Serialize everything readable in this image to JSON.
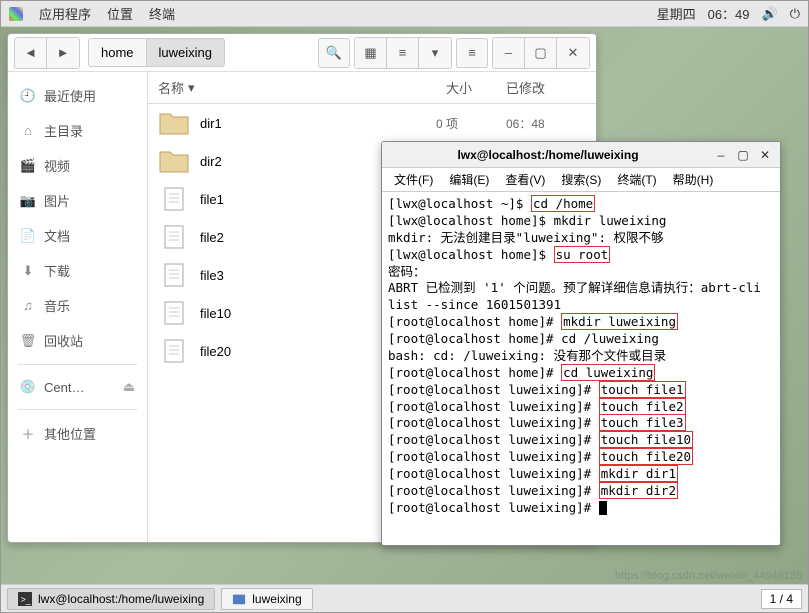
{
  "panel": {
    "apps": "应用程序",
    "places": "位置",
    "terminal": "终端",
    "day": "星期四",
    "time": "06：49"
  },
  "fm": {
    "breadcrumb": [
      "home",
      "luweixing"
    ],
    "cols": {
      "name": "名称",
      "size": "大小",
      "mod": "已修改"
    },
    "rows": [
      {
        "name": "dir1",
        "type": "folder",
        "size": "0 项",
        "mod": "06：48"
      },
      {
        "name": "dir2",
        "type": "folder",
        "size": "",
        "mod": ""
      },
      {
        "name": "file1",
        "type": "file",
        "size": "",
        "mod": ""
      },
      {
        "name": "file2",
        "type": "file",
        "size": "",
        "mod": ""
      },
      {
        "name": "file3",
        "type": "file",
        "size": "",
        "mod": ""
      },
      {
        "name": "file10",
        "type": "file",
        "size": "",
        "mod": ""
      },
      {
        "name": "file20",
        "type": "file",
        "size": "",
        "mod": ""
      }
    ],
    "sidebar": {
      "recent": "最近使用",
      "home": "主目录",
      "videos": "视频",
      "pictures": "图片",
      "documents": "文档",
      "downloads": "下载",
      "music": "音乐",
      "trash": "回收站",
      "cent": "Cent…",
      "other": "其他位置"
    }
  },
  "term": {
    "title": "lwx@localhost:/home/luweixing",
    "menu": [
      "文件(F)",
      "编辑(E)",
      "查看(V)",
      "搜索(S)",
      "终端(T)",
      "帮助(H)"
    ],
    "lines": [
      {
        "pre": "[lwx@localhost ~]$ ",
        "boxed": "cd /home",
        "post": ""
      },
      {
        "pre": "[lwx@localhost home]$ mkdir luweixing",
        "boxed": "",
        "post": ""
      },
      {
        "pre": "mkdir: 无法创建目录\"luweixing\": 权限不够",
        "boxed": "",
        "post": ""
      },
      {
        "pre": "[lwx@localhost home]$ ",
        "boxed": "su root",
        "post": ""
      },
      {
        "pre": "密码：",
        "boxed": "",
        "post": ""
      },
      {
        "pre": "ABRT 已检测到 '1' 个问题。预了解详细信息请执行：abrt-cli list --since 1601501391",
        "boxed": "",
        "post": ""
      },
      {
        "pre": "[root@localhost home]# ",
        "boxed": "mkdir luweixing",
        "post": ""
      },
      {
        "pre": "[root@localhost home]# cd /luweixing",
        "boxed": "",
        "post": ""
      },
      {
        "pre": "bash: cd: /luweixing: 没有那个文件或目录",
        "boxed": "",
        "post": ""
      },
      {
        "pre": "[root@localhost home]# ",
        "boxed": "cd luweixing",
        "post": ""
      },
      {
        "pre": "[root@localhost luweixing]# ",
        "boxed": "touch file1",
        "post": ""
      },
      {
        "pre": "[root@localhost luweixing]# ",
        "boxed": "touch file2",
        "post": ""
      },
      {
        "pre": "[root@localhost luweixing]# ",
        "boxed": "touch file3",
        "post": ""
      },
      {
        "pre": "[root@localhost luweixing]# ",
        "boxed": "touch file10",
        "post": ""
      },
      {
        "pre": "[root@localhost luweixing]# ",
        "boxed": "touch file20",
        "post": ""
      },
      {
        "pre": "[root@localhost luweixing]# ",
        "boxed": "mkdir dir1",
        "post": ""
      },
      {
        "pre": "[root@localhost luweixing]# ",
        "boxed": "mkdir dir2",
        "post": ""
      },
      {
        "pre": "[root@localhost luweixing]# ",
        "boxed": "",
        "post": "",
        "cursor": true
      }
    ]
  },
  "taskbar": {
    "items": [
      {
        "label": "lwx@localhost:/home/luweixing",
        "icon": "term"
      },
      {
        "label": "luweixing",
        "icon": "folder"
      }
    ],
    "workspace": "1 / 4"
  },
  "watermark": "https://blog.csdn.net/weixin_44949135"
}
